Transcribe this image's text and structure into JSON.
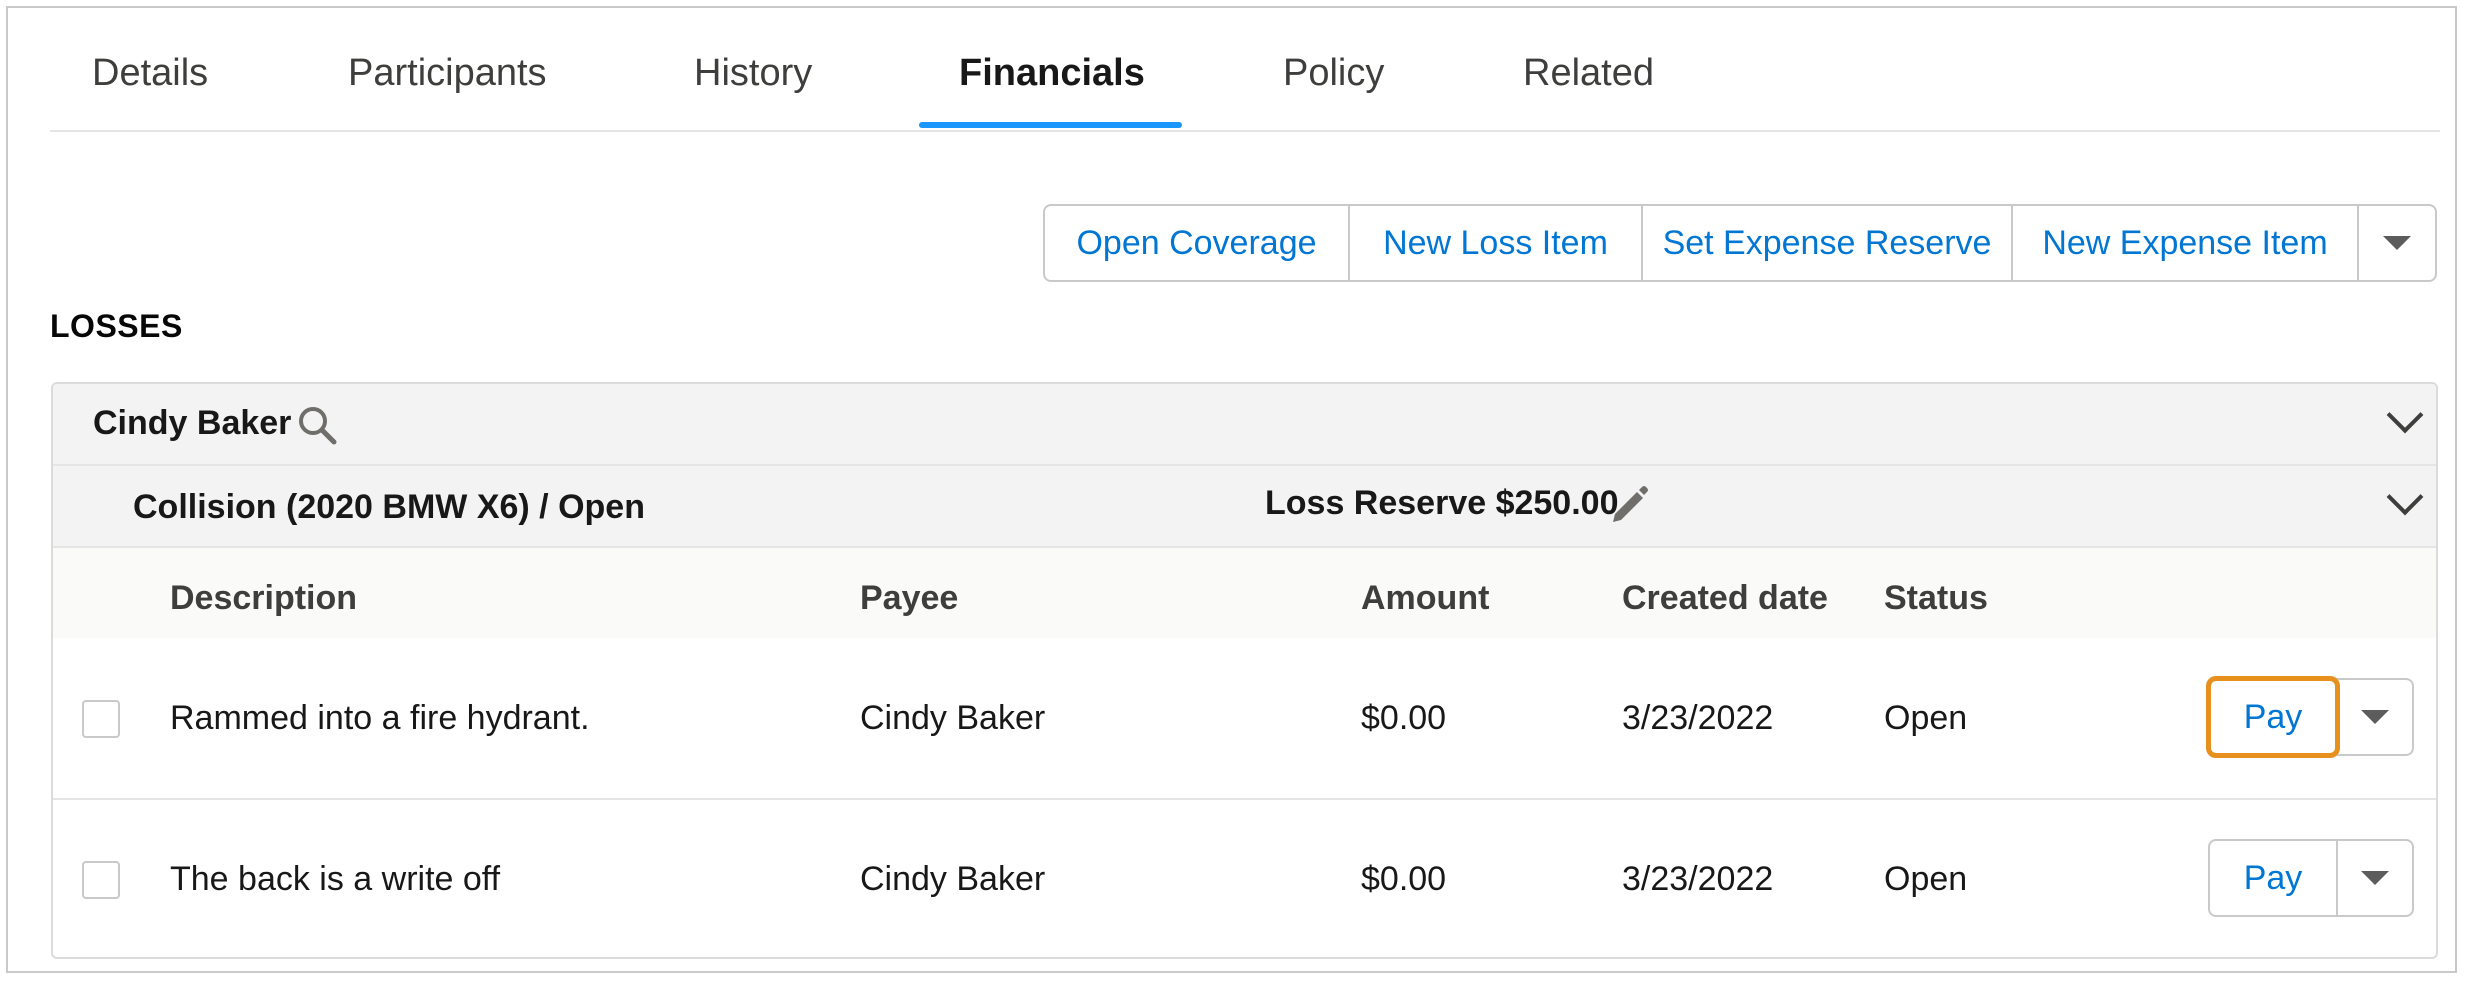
{
  "tabs": [
    {
      "label": "Details"
    },
    {
      "label": "Participants"
    },
    {
      "label": "History"
    },
    {
      "label": "Financials",
      "active": true
    },
    {
      "label": "Policy"
    },
    {
      "label": "Related"
    }
  ],
  "actions": {
    "open_coverage": "Open Coverage",
    "new_loss_item": "New Loss Item",
    "set_expense_reserve": "Set Expense Reserve",
    "new_expense_item": "New Expense Item"
  },
  "section_title": "LOSSES",
  "claimant": {
    "name": "Cindy Baker",
    "coverage": {
      "title": "Collision (2020 BMW X6) / Open",
      "reserve": "Loss Reserve $250.00"
    }
  },
  "table": {
    "columns": [
      "Description",
      "Payee",
      "Amount",
      "Created date",
      "Status"
    ],
    "rows": [
      {
        "description": "Rammed into a fire hydrant.",
        "payee": "Cindy Baker",
        "amount": "$0.00",
        "created": "3/23/2022",
        "status": "Open",
        "action": "Pay"
      },
      {
        "description": "The back is a write off",
        "payee": "Cindy Baker",
        "amount": "$0.00",
        "created": "3/23/2022",
        "status": "Open",
        "action": "Pay"
      }
    ]
  },
  "colors": {
    "accent": "#0176d3",
    "tab_underline": "#1b96ff",
    "highlight": "#e8901e"
  },
  "icons": [
    "search-icon",
    "pencil-icon",
    "chevron-down-icon",
    "caret-down-icon"
  ]
}
